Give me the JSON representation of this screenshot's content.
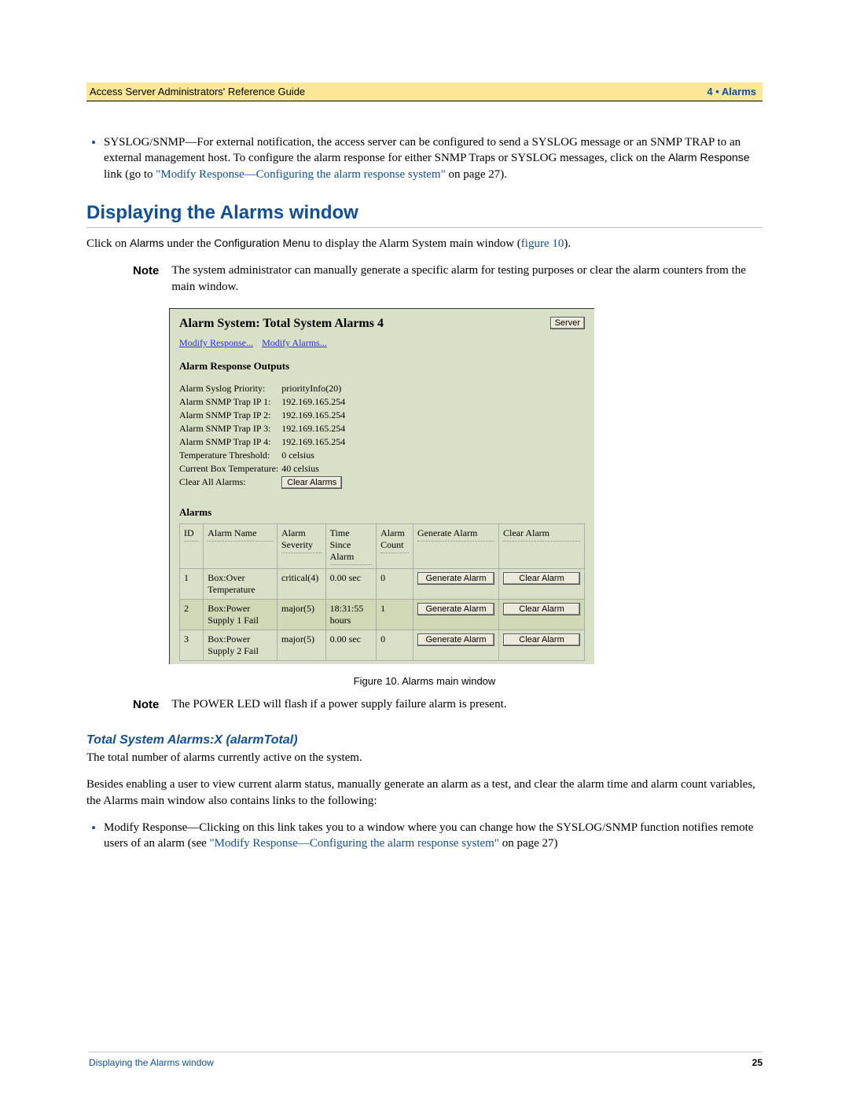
{
  "header": {
    "left": "Access Server Administrators' Reference Guide",
    "right": "4 • Alarms"
  },
  "top_bullet": {
    "lead": "SYSLOG/SNMP—For external notification, the access server can be configured to send a SYSLOG message or an SNMP TRAP to an external management host. To configure the alarm response for either SNMP Traps or SYSLOG messages, click on the ",
    "ui1": "Alarm Response",
    "mid": " link (go to ",
    "link1": "\"Modify Response—Configuring the alarm response system\"",
    "tail": " on page 27)."
  },
  "section_heading": "Displaying the Alarms window",
  "display_para": {
    "pre": "Click on ",
    "ui1": "Alarms",
    "mid1": " under the ",
    "ui2": "Configuration Menu",
    "mid2": " to display the Alarm System main window (",
    "link": "figure 10",
    "post": ")."
  },
  "note1": {
    "label": "Note",
    "text": "The system administrator can manually generate a specific alarm for testing purposes or clear the alarm counters from the main window."
  },
  "screenshot": {
    "title": "Alarm System: Total System Alarms 4",
    "server_btn": "Server",
    "links": {
      "modify_response": "Modify Response...",
      "modify_alarms": "Modify Alarms..."
    },
    "response_heading": "Alarm Response Outputs",
    "kv": [
      {
        "k": "Alarm Syslog Priority:",
        "v": "priorityInfo(20)"
      },
      {
        "k": "Alarm SNMP Trap IP 1:",
        "v": "192.169.165.254"
      },
      {
        "k": "Alarm SNMP Trap IP 2:",
        "v": "192.169.165.254"
      },
      {
        "k": "Alarm SNMP Trap IP 3:",
        "v": "192.169.165.254"
      },
      {
        "k": "Alarm SNMP Trap IP 4:",
        "v": "192.169.165.254"
      },
      {
        "k": "Temperature Threshold:",
        "v": "0 celsius"
      },
      {
        "k": "Current Box Temperature:",
        "v": "40 celsius"
      }
    ],
    "clear_all": {
      "label": "Clear All Alarms:",
      "button": "Clear Alarms"
    },
    "alarms_heading": "Alarms",
    "columns": [
      "ID",
      "Alarm Name",
      "Alarm Severity",
      "Time Since Alarm",
      "Alarm Count",
      "Generate Alarm",
      "Clear Alarm"
    ],
    "rows": [
      {
        "id": "1",
        "name": "Box:Over Temperature",
        "severity": "critical(4)",
        "since": "0.00 sec",
        "count": "0"
      },
      {
        "id": "2",
        "name": "Box:Power Supply 1 Fail",
        "severity": "major(5)",
        "since": "18:31:55 hours",
        "count": "1",
        "hi": true
      },
      {
        "id": "3",
        "name": "Box:Power Supply 2 Fail",
        "severity": "major(5)",
        "since": "0.00 sec",
        "count": "0"
      }
    ],
    "gen_btn": "Generate Alarm",
    "clr_btn": "Clear Alarm"
  },
  "figure_caption": "Figure 10. Alarms main window",
  "note2": {
    "label": "Note",
    "text": "The POWER LED will flash if a power supply failure alarm is present."
  },
  "subsection_heading": "Total System Alarms:X (alarmTotal)",
  "sub_para1": "The total number of alarms currently active on the system.",
  "sub_para2": "Besides enabling a user to view current alarm status, manually generate an alarm as a test, and clear the alarm time and alarm count variables, the Alarms main window also contains links to the following:",
  "bottom_bullet": {
    "lead": "Modify Response—Clicking on this link takes you to a window where you can change how the SYSLOG/SNMP function notifies remote users of an alarm (see ",
    "link": "\"Modify Response—Configuring the alarm response system\"",
    "tail": " on page 27)"
  },
  "footer": {
    "left": "Displaying the Alarms window",
    "page": "25"
  }
}
